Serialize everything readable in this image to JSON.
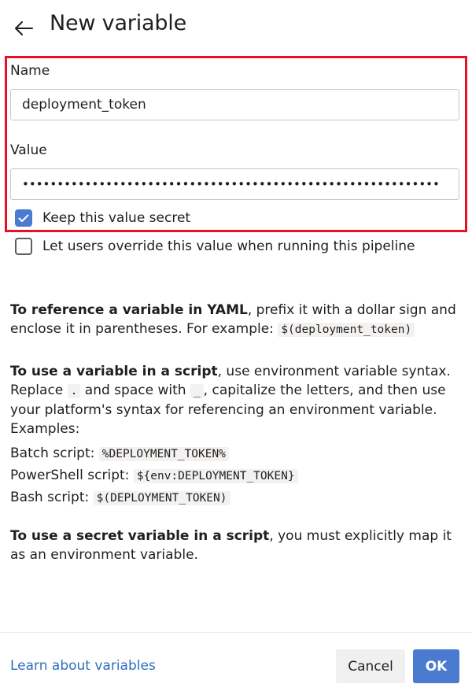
{
  "header": {
    "back_icon": "arrow-left-icon",
    "title": "New variable"
  },
  "form": {
    "name_label": "Name",
    "name_value": "deployment_token",
    "value_label": "Value",
    "value_masked": "••••••••••••••••••••••••••••••••••••••••••••••••••••••••••••",
    "keep_secret": {
      "label": "Keep this value secret",
      "checked": true
    },
    "allow_override": {
      "label": "Let users override this value when running this pipeline",
      "checked": false
    },
    "highlight_color": "#e81123"
  },
  "help": {
    "yaml_bold": "To reference a variable in YAML",
    "yaml_text": ", prefix it with a dollar sign and enclose it in parentheses. For example: ",
    "yaml_code": "$(deployment_token)",
    "script_bold": "To use a variable in a script",
    "script_text1": ", use environment variable syntax. Replace ",
    "script_code_dot": ".",
    "script_text2": " and space with ",
    "script_code_us": "_",
    "script_text3": ", capitalize the letters, and then use your platform's syntax for referencing an environment variable. Examples:",
    "batch_label": "Batch script: ",
    "batch_code": "%DEPLOYMENT_TOKEN%",
    "ps_label": "PowerShell script: ",
    "ps_code": "${env:DEPLOYMENT_TOKEN}",
    "bash_label": "Bash script: ",
    "bash_code": "$(DEPLOYMENT_TOKEN)",
    "secret_bold": "To use a secret variable in a script",
    "secret_text": ", you must explicitly map it as an environment variable."
  },
  "footer": {
    "learn_link": "Learn about variables",
    "cancel_label": "Cancel",
    "ok_label": "OK"
  },
  "colors": {
    "accent": "#4a7bd0",
    "link": "#2f6fbd"
  }
}
